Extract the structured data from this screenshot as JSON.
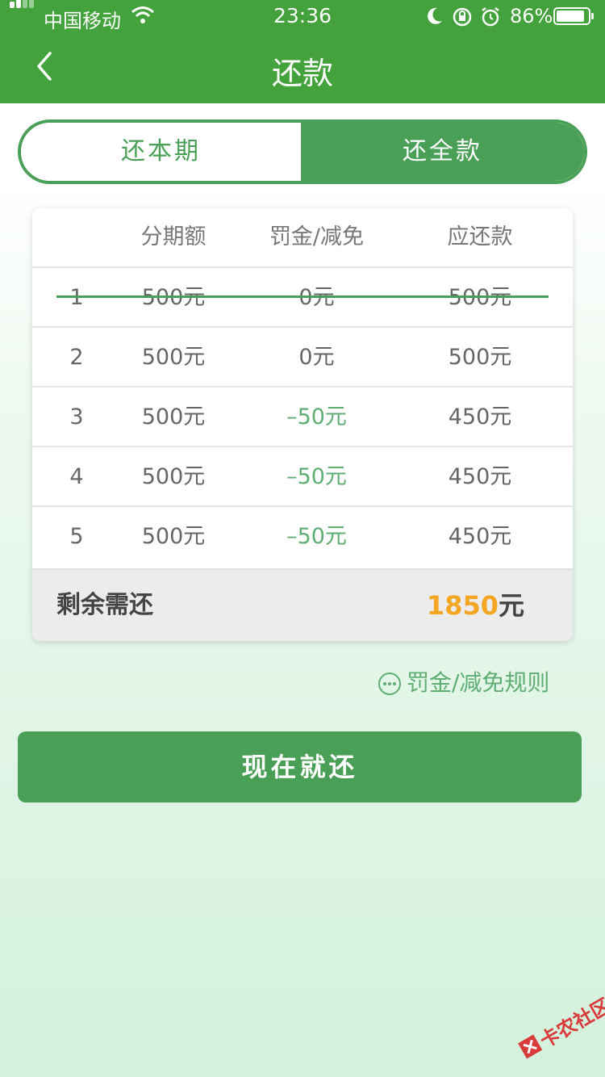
{
  "status_bar": {
    "carrier": "中国移动",
    "time": "23:36",
    "battery": "86%"
  },
  "nav": {
    "title": "还款"
  },
  "segments": {
    "left": "还本期",
    "right": "还全款"
  },
  "table": {
    "headers": [
      "",
      "分期额",
      "罚金/减免",
      "应还款"
    ],
    "rows": [
      {
        "index": "1",
        "amount": "500元",
        "fine": "0元",
        "due": "500元"
      },
      {
        "index": "2",
        "amount": "500元",
        "fine": "0元",
        "due": "500元"
      },
      {
        "index": "3",
        "amount": "500元",
        "fine": "–50元",
        "due": "450元"
      },
      {
        "index": "4",
        "amount": "500元",
        "fine": "–50元",
        "due": "450元"
      },
      {
        "index": "5",
        "amount": "500元",
        "fine": "–50元",
        "due": "450元"
      }
    ],
    "remaining_label": "剩余需还",
    "remaining_amount": "1850",
    "remaining_unit": "元"
  },
  "rules_link": "罚金/减免规则",
  "pay_button": "现在就还",
  "watermark": "卡农社区",
  "colors": {
    "header_green": "#43a23c",
    "accent_green": "#4a9f57",
    "amount_orange": "#f5a623"
  }
}
